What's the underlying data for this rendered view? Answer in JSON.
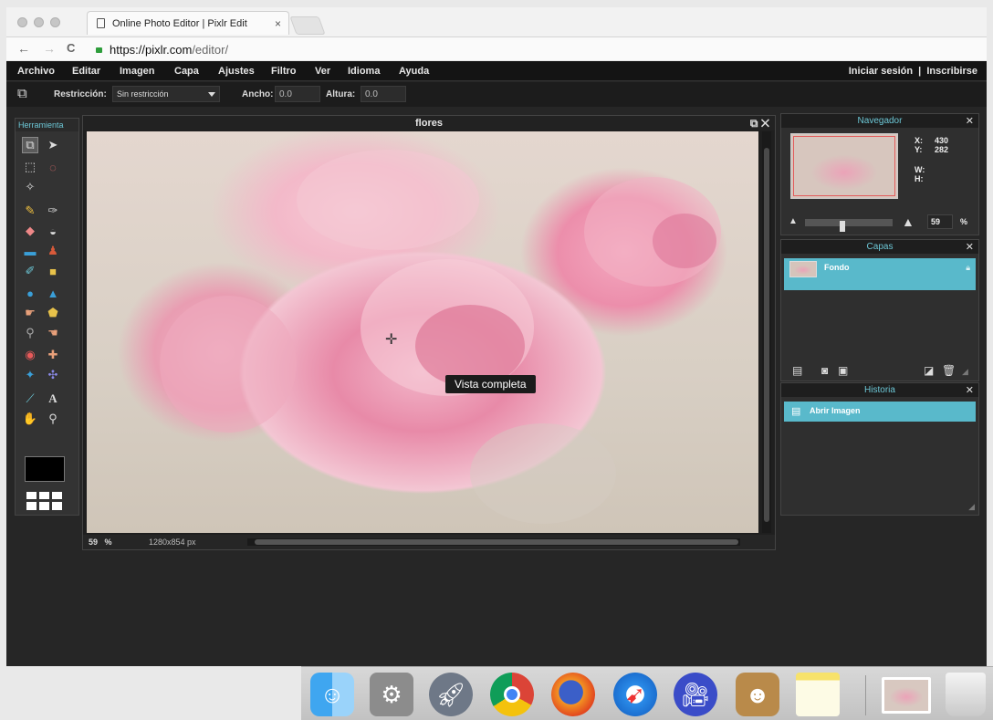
{
  "browser": {
    "tab_title": "Online Photo Editor | Pixlr Edit",
    "tab_close": "×",
    "url_host": "https://pixlr.com",
    "url_path": "/editor/",
    "back": "←",
    "forward": "→",
    "reload": "C"
  },
  "menubar": {
    "items": [
      "Archivo",
      "Editar",
      "Imagen",
      "Capa",
      "Ajustes",
      "Filtro",
      "Ver",
      "Idioma",
      "Ayuda"
    ],
    "account": "Iniciar sesión  |  Inscribirse"
  },
  "options": {
    "restriction_label": "Restricción:",
    "restriction_value": "Sin restricción",
    "width_label": "Ancho:",
    "width_value": "0.0",
    "height_label": "Altura:",
    "height_value": "0.0"
  },
  "toolbox": {
    "title": "Herramienta"
  },
  "canvas": {
    "title": "flores",
    "tooltip": "Vista completa",
    "zoom": "59",
    "zoom_unit": "%",
    "size": "1280x854 px"
  },
  "navigator": {
    "title": "Navegador",
    "x_label": "X:",
    "x_value": "430",
    "y_label": "Y:",
    "y_value": "282",
    "w_label": "W:",
    "h_label": "H:",
    "zoom_value": "59",
    "zoom_unit": "%"
  },
  "layers": {
    "title": "Capas",
    "layer_name": "Fondo"
  },
  "history": {
    "title": "Historia",
    "entry": "Abrir Imagen"
  },
  "colors": {
    "accent": "#59b9cb",
    "panel_title": "#6cc7d6",
    "app_bg": "#262626"
  }
}
